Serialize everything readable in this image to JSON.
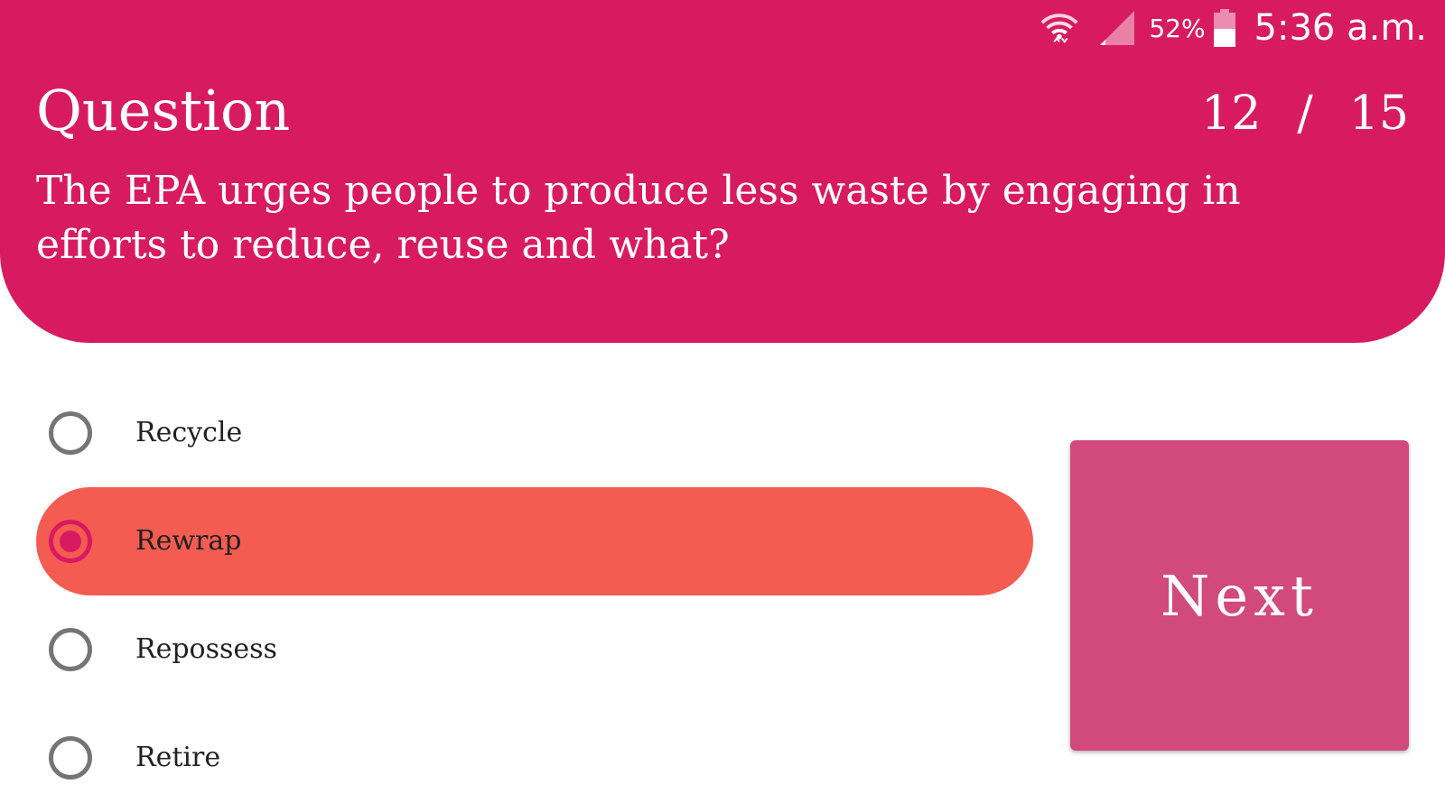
{
  "status_bar": {
    "battery_percent": "52%",
    "time": "5:36 a.m.",
    "icons": [
      "wifi-icon",
      "signal-icon",
      "battery-icon"
    ]
  },
  "header": {
    "title": "Question",
    "current": "12",
    "separator": "/",
    "total": "15",
    "question_text": "The EPA urges people to produce less waste by engaging in efforts to reduce, reuse and what?"
  },
  "options": [
    {
      "label": "Recycle",
      "selected": false
    },
    {
      "label": "Rewrap",
      "selected": true
    },
    {
      "label": "Repossess",
      "selected": false
    },
    {
      "label": "Retire",
      "selected": false
    }
  ],
  "next_button": {
    "label": "Next"
  },
  "colors": {
    "header": "#d81b60",
    "selected_option": "#f45c51",
    "next_button": "#d2497b"
  }
}
